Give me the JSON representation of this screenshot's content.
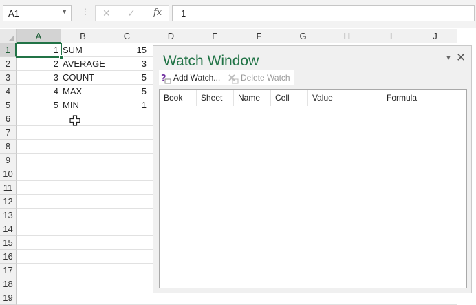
{
  "formula_bar": {
    "name_box": "A1",
    "cancel_icon": "✕",
    "enter_icon": "✓",
    "fx_icon": "fx",
    "formula": "1"
  },
  "columns": [
    "A",
    "B",
    "C",
    "D",
    "E",
    "F",
    "G",
    "H",
    "I",
    "J"
  ],
  "rows": [
    "1",
    "2",
    "3",
    "4",
    "5",
    "6",
    "7",
    "8",
    "9",
    "10",
    "11",
    "12",
    "13",
    "14",
    "15",
    "16",
    "17",
    "18",
    "19"
  ],
  "cells": {
    "A": [
      "1",
      "2",
      "3",
      "4",
      "5"
    ],
    "B": [
      "SUM",
      "AVERAGE",
      "COUNT",
      "MAX",
      "MIN"
    ],
    "C": [
      "15",
      "3",
      "5",
      "5",
      "1"
    ]
  },
  "selected_cell": "A1",
  "accent_color": "#217346",
  "watch_window": {
    "title": "Watch Window",
    "add_watch_label": "Add Watch...",
    "delete_watch_label": "Delete Watch",
    "headers": [
      "Book",
      "Sheet",
      "Name",
      "Cell",
      "Value",
      "Formula"
    ]
  }
}
